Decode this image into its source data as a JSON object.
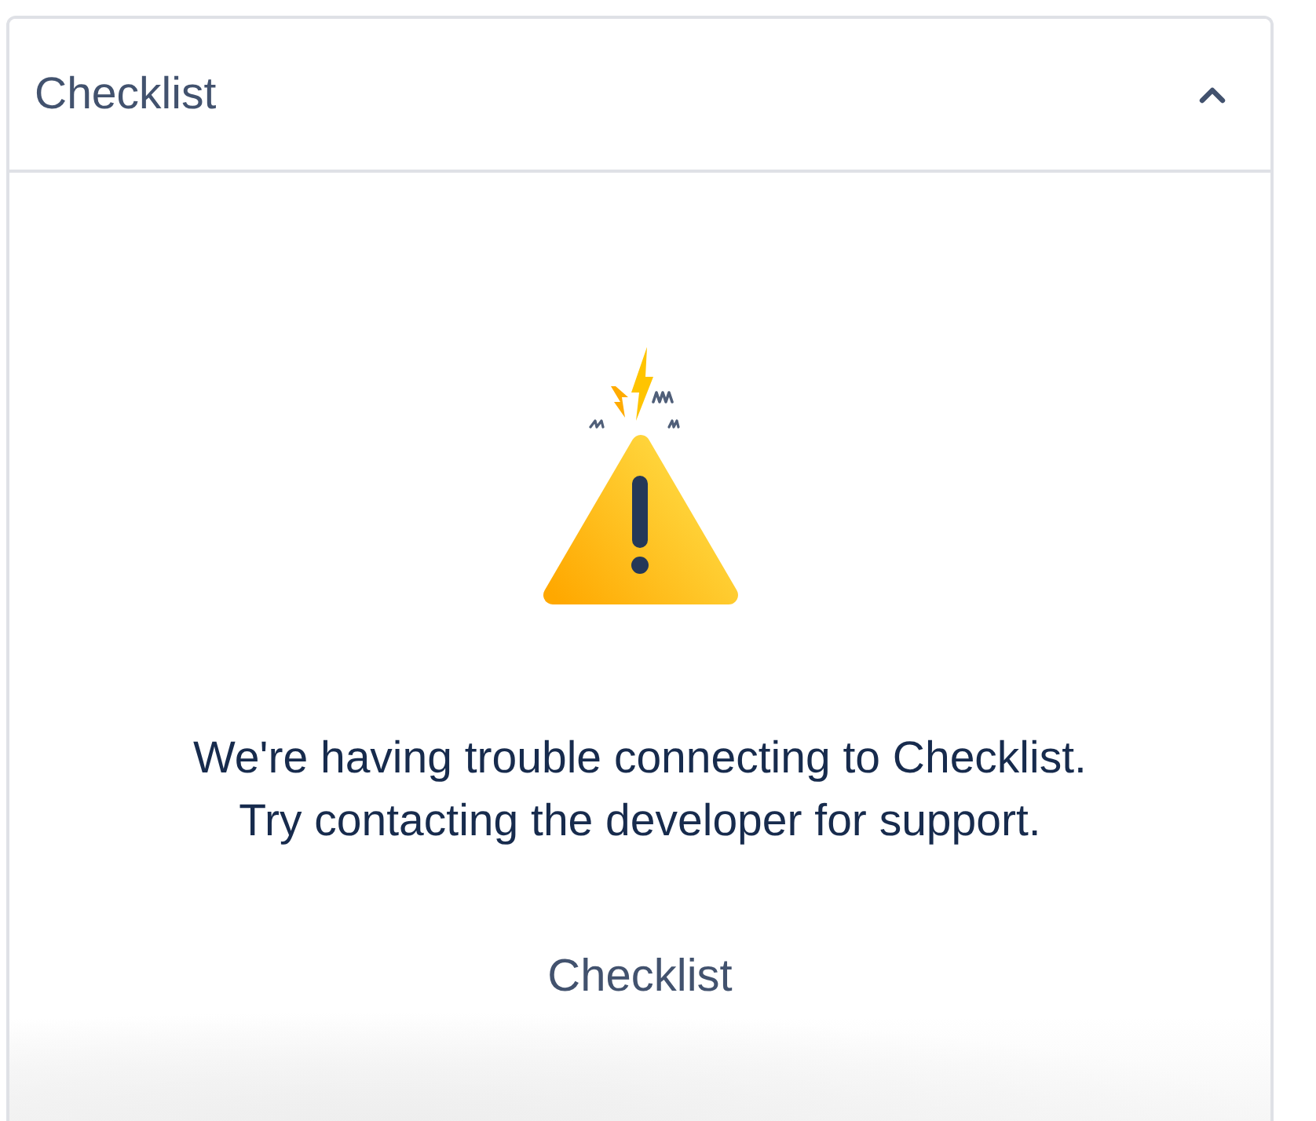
{
  "panel": {
    "title": "Checklist",
    "expanded": true
  },
  "error": {
    "message_lines": [
      "We're having trouble connecting to Checklist.",
      "Try contacting the developer for support."
    ],
    "link": "Checklist"
  }
}
